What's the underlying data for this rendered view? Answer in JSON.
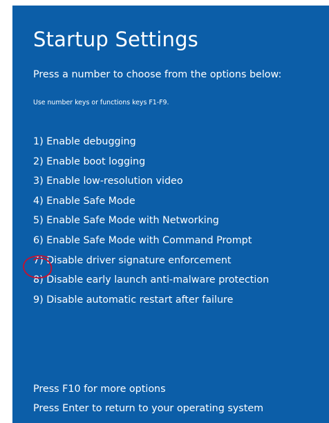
{
  "screen": {
    "title": "Startup Settings",
    "instruction": "Press a number to choose from the options below:",
    "hint": "Use number keys or functions keys F1-F9.",
    "options": [
      {
        "label": "1) Enable debugging"
      },
      {
        "label": "2) Enable boot logging"
      },
      {
        "label": "3) Enable low-resolution video"
      },
      {
        "label": "4) Enable Safe Mode"
      },
      {
        "label": "5) Enable Safe Mode with Networking"
      },
      {
        "label": "6) Enable Safe Mode with Command Prompt"
      },
      {
        "label": "7) Disable driver signature enforcement"
      },
      {
        "label": "8) Disable early launch anti-malware protection"
      },
      {
        "label": "9) Disable automatic restart after failure"
      }
    ],
    "footer": {
      "more_options": "Press F10 for more options",
      "return": "Press Enter to return to your operating system"
    }
  },
  "colors": {
    "background": "#0c5ea8",
    "text": "#ffffff",
    "annotation": "#c8102e"
  },
  "annotation": {
    "icon": "red-hand-drawn-circle",
    "highlights_option": 7
  }
}
